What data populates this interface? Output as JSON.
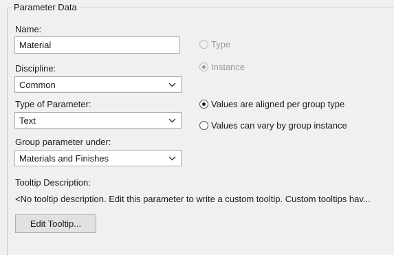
{
  "group": {
    "title": "Parameter Data"
  },
  "name": {
    "label": "Name:",
    "value": "Material"
  },
  "discipline": {
    "label": "Discipline:",
    "value": "Common"
  },
  "type_of_parameter": {
    "label": "Type of Parameter:",
    "value": "Text"
  },
  "group_under": {
    "label": "Group parameter under:",
    "value": "Materials and Finishes"
  },
  "type_instance": {
    "type_label": "Type",
    "type_selected": false,
    "type_enabled": false,
    "instance_label": "Instance",
    "instance_selected": true,
    "instance_enabled": false
  },
  "group_values": {
    "aligned_label": "Values are aligned per group type",
    "aligned_selected": true,
    "vary_label": "Values can vary by group instance",
    "vary_selected": false
  },
  "tooltip": {
    "label": "Tooltip Description:",
    "text": "<No tooltip description. Edit this parameter to write a custom tooltip. Custom tooltips hav...",
    "edit_button": "Edit Tooltip..."
  }
}
